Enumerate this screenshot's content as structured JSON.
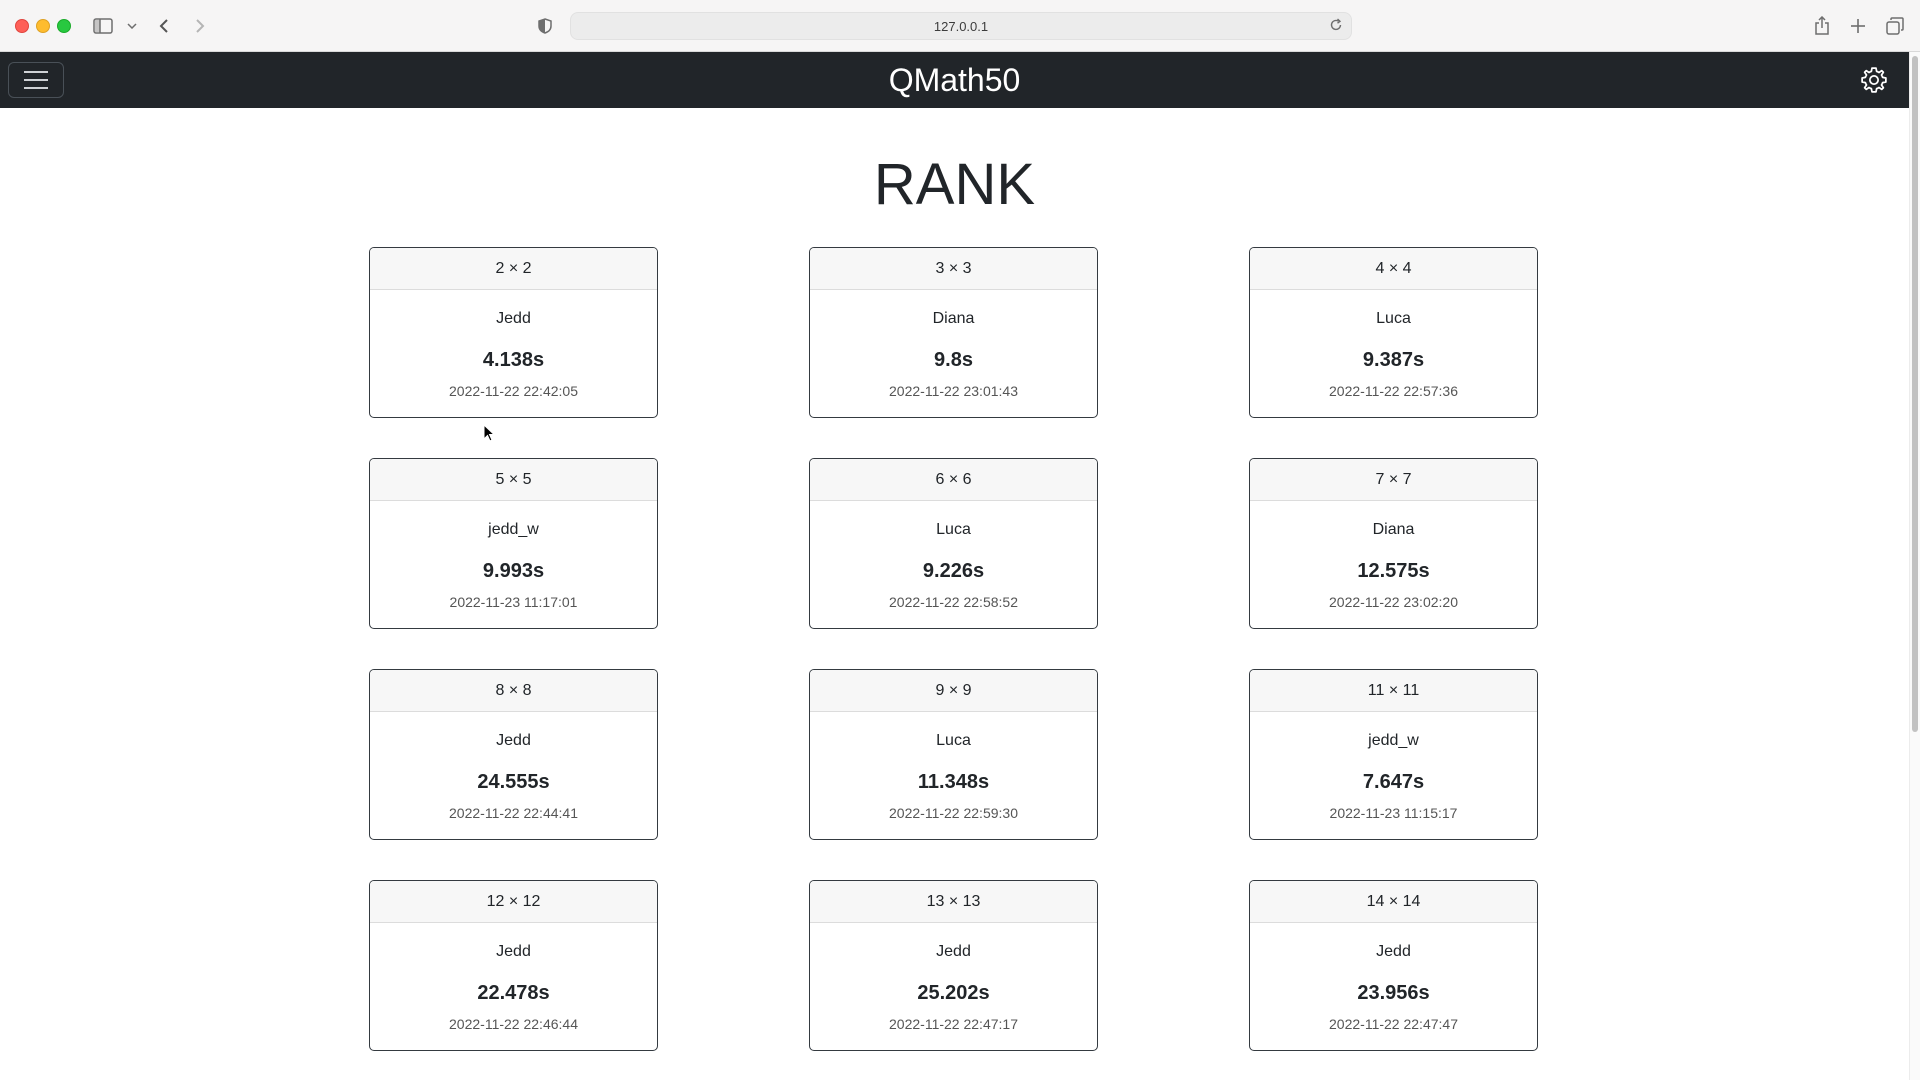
{
  "browser": {
    "url": "127.0.0.1"
  },
  "navbar": {
    "brand": "QMath50"
  },
  "page": {
    "title": "RANK"
  },
  "ranks": [
    {
      "size": "2 × 2",
      "player": "Jedd",
      "time": "4.138s",
      "date": "2022-11-22 22:42:05"
    },
    {
      "size": "3 × 3",
      "player": "Diana",
      "time": "9.8s",
      "date": "2022-11-22 23:01:43"
    },
    {
      "size": "4 × 4",
      "player": "Luca",
      "time": "9.387s",
      "date": "2022-11-22 22:57:36"
    },
    {
      "size": "5 × 5",
      "player": "jedd_w",
      "time": "9.993s",
      "date": "2022-11-23 11:17:01"
    },
    {
      "size": "6 × 6",
      "player": "Luca",
      "time": "9.226s",
      "date": "2022-11-22 22:58:52"
    },
    {
      "size": "7 × 7",
      "player": "Diana",
      "time": "12.575s",
      "date": "2022-11-22 23:02:20"
    },
    {
      "size": "8 × 8",
      "player": "Jedd",
      "time": "24.555s",
      "date": "2022-11-22 22:44:41"
    },
    {
      "size": "9 × 9",
      "player": "Luca",
      "time": "11.348s",
      "date": "2022-11-22 22:59:30"
    },
    {
      "size": "11 × 11",
      "player": "jedd_w",
      "time": "7.647s",
      "date": "2022-11-23 11:15:17"
    },
    {
      "size": "12 × 12",
      "player": "Jedd",
      "time": "22.478s",
      "date": "2022-11-22 22:46:44"
    },
    {
      "size": "13 × 13",
      "player": "Jedd",
      "time": "25.202s",
      "date": "2022-11-22 22:47:17"
    },
    {
      "size": "14 × 14",
      "player": "Jedd",
      "time": "23.956s",
      "date": "2022-11-22 22:47:47"
    }
  ]
}
